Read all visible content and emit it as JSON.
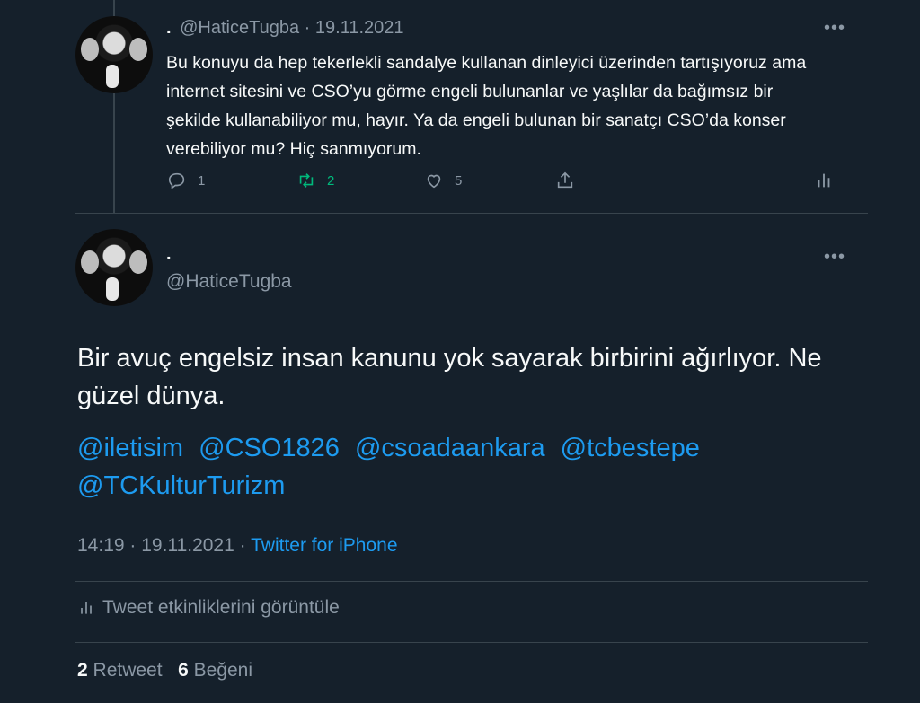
{
  "reply": {
    "display_name": ".",
    "handle": "@HaticeTugba",
    "separator": "·",
    "date": "19.11.2021",
    "text": "Bu konuyu da hep tekerlekli sandalye kullanan dinleyici üzerinden tartışıyoruz ama internet sitesini ve CSO’yu görme engeli bulunanlar ve yaşlılar da bağımsız bir şekilde kullanabiliyor mu, hayır. Ya da engeli bulunan bir sanatçı CSO’da konser verebiliyor mu? Hiç sanmıyorum.",
    "reply_count": "1",
    "retweet_count": "2",
    "like_count": "5"
  },
  "main": {
    "display_name": ".",
    "handle": "@HaticeTugba",
    "text": "Bir avuç engelsiz insan kanunu yok sayarak birbirini ağırlıyor. Ne güzel dünya.",
    "mentions": [
      "@iletisim",
      "@CSO1826",
      "@csoadaankara",
      "@tcbestepe",
      "@TCKulturTurizm"
    ],
    "time": "14:19",
    "separator": "·",
    "date": "19.11.2021",
    "separator2": "·",
    "client": "Twitter for iPhone",
    "analytics_label": "Tweet etkinliklerini görüntüle",
    "retweets_count": "2",
    "retweets_label": "Retweet",
    "likes_count": "6",
    "likes_label": "Beğeni"
  },
  "colors": {
    "background": "#15202b",
    "text": "#f7f9f9",
    "muted": "#8b98a5",
    "link": "#1d9bf0",
    "retweet_active": "#00ba7c",
    "border": "#38444d"
  },
  "icons": [
    "more-icon",
    "reply-icon",
    "retweet-icon",
    "like-icon",
    "share-icon",
    "analytics-icon"
  ]
}
